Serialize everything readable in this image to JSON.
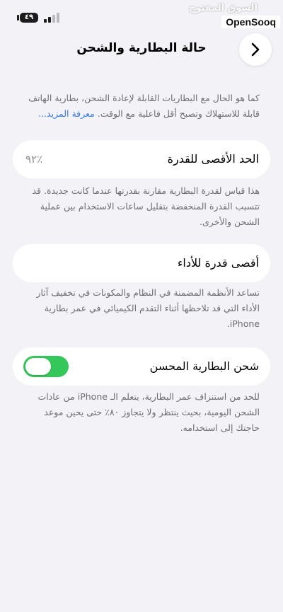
{
  "status_bar": {
    "battery_level": "٤٩",
    "watermark_arabic": "السوق المفتوح",
    "watermark_brand": "OpenSooq"
  },
  "header": {
    "title": "حالة البطارية والشحن",
    "back_icon": "chevron-right-icon"
  },
  "intro": {
    "text": "كما هو الحال مع البطاريات القابلة لإعادة الشحن، بطارية الهاتف قابلة للاستهلاك وتصبح أقل فاعلية مع الوقت.",
    "learn_more": "معرفة المزيد..."
  },
  "max_capacity": {
    "label": "الحد الأقصى للقدرة",
    "value": "٪٩٢",
    "description": "هذا قياس لقدرة البطارية مقارنة بقدرتها عندما كانت جديدة. قد تتسبب القدرة المنخفضة بتقليل ساعات الاستخدام بين عملية الشحن والأخرى."
  },
  "peak_performance": {
    "label": "أقصى قدرة للأداء",
    "description": "تساعد الأنظمة المضمنة في النظام والمكونات في تخفيف آثار الأداء التي قد تلاحظها أثناء التقدم الكيميائي في عمر بطارية iPhone."
  },
  "optimized_charging": {
    "label": "شحن البطارية المحسن",
    "enabled": true,
    "description": "للحد من استنزاف عمر البطارية، يتعلم الـ iPhone من عادات الشحن اليومية، بحيث ينتظر ولا يتجاوز ٨٠٪ حتى يحين موعد حاجتك إلى استخدامه."
  },
  "colors": {
    "background": "#f2f2f7",
    "link": "#3478f6",
    "toggle_on": "#34c759",
    "secondary_text": "#6d6d72"
  }
}
